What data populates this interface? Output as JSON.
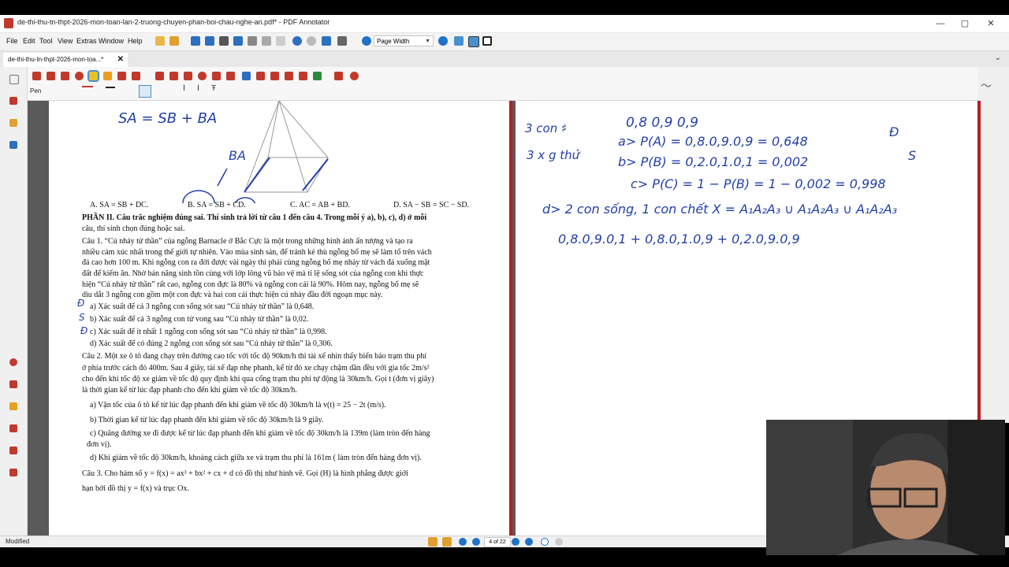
{
  "window": {
    "title": "de-thi-thu-tn-thpt-2026-mon-toan-lan-2-truong-chuyen-phan-boi-chau-nghe-an.pdf* - PDF Annotator"
  },
  "menu": [
    "File",
    "Edit",
    "Tool",
    "View",
    "Extras",
    "Window",
    "Help"
  ],
  "toolbar": {
    "zoom_select": "Page Width"
  },
  "tab": {
    "label": "de-thi-thu-tn-thpt-2026-mon-toa...*",
    "close": "✕"
  },
  "tool_panel": {
    "current_tool": "Pen"
  },
  "document": {
    "handwritten_vector": "SA = SB + BA",
    "handwritten_ba": "BA",
    "answers": {
      "a": "A. SA = SB + DC.",
      "b": "B. SA = SB + CD.",
      "c": "C. AC = AB + BD.",
      "d": "D. SA − SB = SC − SD."
    },
    "lines": [
      "PHẦN II. Câu trắc nghiệm đúng sai. Thí sinh trả lời từ câu 1 đến câu 4. Trong mỗi ý a), b), c), d) ở mỗi",
      "câu, thí sinh chọn đúng hoặc sai.",
      "Câu 1. “Cú nhảy tử thần” của ngỗng Barnacle ở Bắc Cực là một trong những hình ảnh ấn tượng và tạo ra",
      "nhiều cảm xúc nhất trong thế giới tự nhiên. Vào mùa sinh sản, để tránh kẻ thù ngỗng bố mẹ sẽ làm tổ trên vách",
      "đá cao hơn 100 m. Khi ngỗng con ra đời được vài ngày thì phải cùng ngỗng bố mẹ nhảy từ vách đá xuống mặt",
      "đất để kiếm ăn. Nhờ bản năng sinh tồn cùng với lớp lông vũ bảo vệ mà tỉ lệ sống sót của ngỗng con khi thực",
      "hiện “Cú nhảy tử thần” rất cao, ngỗng con đực là 80% và ngỗng con cái là 90%. Hôm nay, ngỗng bố mẹ sẽ",
      "dìu dắt 3 ngỗng con gồm một con đực và hai con cái thực hiện cú nhảy đầu đời ngoạn mục này.",
      "a) Xác suất để cả 3 ngỗng con sống sót sau “Cú nhảy tử thần” là 0,648.",
      "b) Xác suất để cả 3 ngỗng con tử vong sau “Cú nhảy tử thần” là 0,02.",
      "c) Xác suất để ít nhất 1 ngỗng con sống sót sau “Cú nhảy tử thần” là 0,998.",
      "d) Xác suất để có đúng 2 ngỗng con sống sót sau “Cú nhảy tử thần” là 0,306.",
      "Câu 2. Một xe ô tô đang chạy trên đường cao tốc với tốc độ 90km/h thì tài xế nhìn thấy biển báo trạm thu phí",
      "ở phía trước cách đó 400m. Sau 4 giây, tài xế đạp nhẹ phanh, kể từ đó xe chạy chậm dần đều với gia tốc 2m/s²",
      "cho đến khi tốc độ xe giảm về tốc độ quy định khi qua cổng trạm thu phí tự động là 30km/h. Gọi t (đơn vị giây)",
      "là thời gian kể từ lúc đạp phanh cho đến khi giảm về tốc độ 30km/h.",
      "a) Vận tốc của ô tô kể từ lúc đạp phanh đến khi giảm về tốc độ 30km/h là v(t) = 25 − 2t (m/s).",
      "b) Thời gian kể từ lúc đạp phanh đến khi giảm về tốc độ 30km/h là 9 giây.",
      "c) Quãng đường xe đi được kể từ lúc đạp phanh đến khi giảm về tốc độ 30km/h là 139m (làm tròn đến hàng",
      "đơn vị).",
      "d) Khi giảm về tốc độ 30km/h, khoảng cách giữa xe và trạm thu phí là 161m ( làm tròn đến hàng đơn vị).",
      "Câu 3. Cho hàm số y = f(x) = ax³ + bx² + cx + d có đồ thị như hình vẽ. Gọi (H) là hình phẳng được giới",
      "hạn bởi đồ thị y = f(x) và trục Ox."
    ],
    "margin_marks": [
      "Đ",
      "S",
      "Đ"
    ]
  },
  "notes": {
    "n1": "3 con ♯",
    "n2": "3 x g thử",
    "n3": "0,8   0,9   0,9",
    "n4": "a> P(A) = 0,8.0,9.0,9 = 0,648",
    "n4mark": "Đ",
    "n5": "b> P(B) = 0,2.0,1.0,1 = 0,002",
    "n5mark": "S",
    "n6": "c> P(C) = 1 − P(B) = 1 − 0,002 = 0,998",
    "n7": "d> 2 con sống, 1 con chết   X = A₁A₂A₃ ∪ A₁A₂A₃ ∪ A₁A₂A₃",
    "n8": "0,8.0,9.0,1 + 0,8.0,1.0,9 + 0,2.0,9.0,9"
  },
  "statusbar": {
    "state": "Modified",
    "page_indicator": "4 of 22"
  },
  "colors": {
    "accent_blue": "#1e72c8",
    "annotation_red": "#b52020",
    "ink_blue": "#2340a8"
  }
}
